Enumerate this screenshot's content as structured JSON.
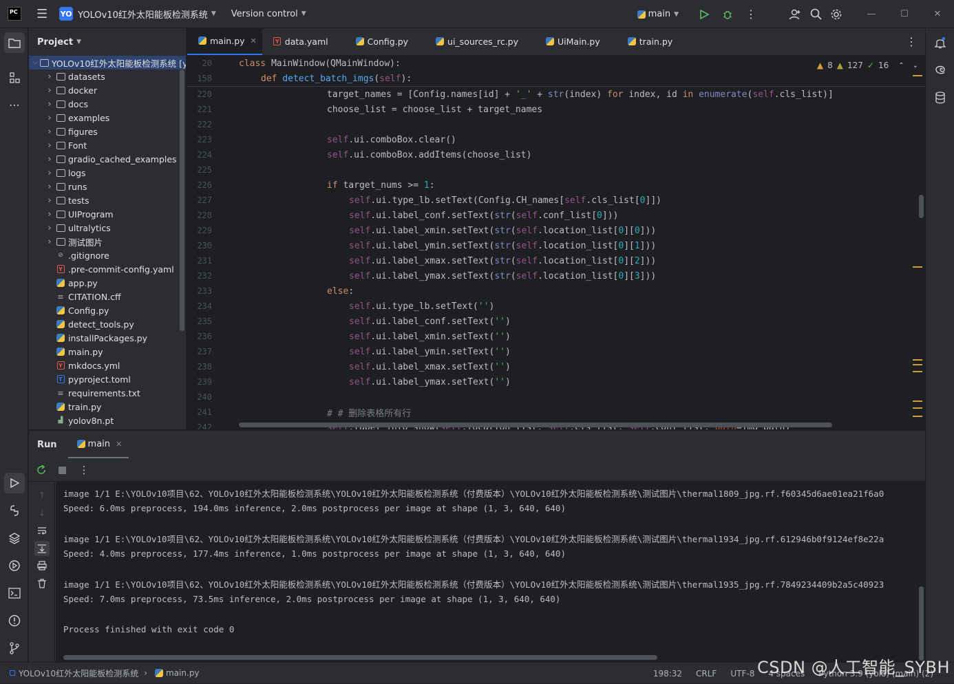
{
  "titlebar": {
    "logo": "PC",
    "project_badge": "YO",
    "project_name": "YOLOv10红外太阳能板检测系统",
    "vcs_label": "Version control",
    "run_config": "main"
  },
  "project_panel": {
    "title": "Project",
    "root": "YOLOv10红外太阳能板检测系统 [y",
    "items": [
      {
        "label": "datasets",
        "type": "folder"
      },
      {
        "label": "docker",
        "type": "folder"
      },
      {
        "label": "docs",
        "type": "folder"
      },
      {
        "label": "examples",
        "type": "folder"
      },
      {
        "label": "figures",
        "type": "folder"
      },
      {
        "label": "Font",
        "type": "folder"
      },
      {
        "label": "gradio_cached_examples",
        "type": "folder"
      },
      {
        "label": "logs",
        "type": "folder"
      },
      {
        "label": "runs",
        "type": "folder"
      },
      {
        "label": "tests",
        "type": "folder"
      },
      {
        "label": "UIProgram",
        "type": "package"
      },
      {
        "label": "ultralytics",
        "type": "package"
      },
      {
        "label": "测试图片",
        "type": "folder"
      },
      {
        "label": ".gitignore",
        "type": "ignore"
      },
      {
        "label": ".pre-commit-config.yaml",
        "type": "yaml"
      },
      {
        "label": "app.py",
        "type": "py"
      },
      {
        "label": "CITATION.cff",
        "type": "txt"
      },
      {
        "label": "Config.py",
        "type": "py"
      },
      {
        "label": "detect_tools.py",
        "type": "py"
      },
      {
        "label": "installPackages.py",
        "type": "py"
      },
      {
        "label": "main.py",
        "type": "py"
      },
      {
        "label": "mkdocs.yml",
        "type": "yaml"
      },
      {
        "label": "pyproject.toml",
        "type": "toml"
      },
      {
        "label": "requirements.txt",
        "type": "txt"
      },
      {
        "label": "train.py",
        "type": "py"
      },
      {
        "label": "yolov8n.pt",
        "type": "pt"
      }
    ]
  },
  "editor_tabs": [
    {
      "label": "main.py",
      "icon": "py",
      "active": true
    },
    {
      "label": "data.yaml",
      "icon": "yaml",
      "active": false
    },
    {
      "label": "Config.py",
      "icon": "py",
      "active": false
    },
    {
      "label": "ui_sources_rc.py",
      "icon": "py",
      "active": false
    },
    {
      "label": "UiMain.py",
      "icon": "py",
      "active": false
    },
    {
      "label": "train.py",
      "icon": "py",
      "active": false
    }
  ],
  "inspections": {
    "warnings": "8",
    "weak_warnings": "127",
    "typos": "16"
  },
  "code_lines": [
    {
      "n": "20",
      "indent": 0,
      "toks": [
        [
          "kw",
          "class "
        ],
        [
          "tx",
          "MainWindow(QMainWindow):"
        ]
      ]
    },
    {
      "n": "158",
      "indent": 4,
      "toks": [
        [
          "kw",
          "def "
        ],
        [
          "fn",
          "detect_batch_imgs"
        ],
        [
          "tx",
          "("
        ],
        [
          "self",
          "self"
        ],
        [
          "tx",
          "):"
        ]
      ]
    },
    {
      "n": "220",
      "indent": 16,
      "toks": [
        [
          "tx",
          "target_names = [Config.names[id] + "
        ],
        [
          "str",
          "'_'"
        ],
        [
          "tx",
          " + "
        ],
        [
          "bi",
          "str"
        ],
        [
          "tx",
          "(index) "
        ],
        [
          "kw",
          "for "
        ],
        [
          "tx",
          "index, id "
        ],
        [
          "kw",
          "in "
        ],
        [
          "bi",
          "enumerate"
        ],
        [
          "tx",
          "("
        ],
        [
          "self",
          "self"
        ],
        [
          "tx",
          ".cls_list)]"
        ]
      ]
    },
    {
      "n": "221",
      "indent": 16,
      "toks": [
        [
          "tx",
          "choose_list = choose_list + target_names"
        ]
      ]
    },
    {
      "n": "222",
      "indent": 0,
      "toks": []
    },
    {
      "n": "223",
      "indent": 16,
      "toks": [
        [
          "self",
          "self"
        ],
        [
          "tx",
          ".ui.comboBox.clear()"
        ]
      ]
    },
    {
      "n": "224",
      "indent": 16,
      "toks": [
        [
          "self",
          "self"
        ],
        [
          "tx",
          ".ui.comboBox.addItems(choose_list)"
        ]
      ]
    },
    {
      "n": "225",
      "indent": 0,
      "toks": []
    },
    {
      "n": "226",
      "indent": 16,
      "toks": [
        [
          "kw",
          "if "
        ],
        [
          "tx",
          "target_nums >= "
        ],
        [
          "num",
          "1"
        ],
        [
          "tx",
          ":"
        ]
      ]
    },
    {
      "n": "227",
      "indent": 20,
      "toks": [
        [
          "self",
          "self"
        ],
        [
          "tx",
          ".ui.type_lb.setText(Config.CH_names["
        ],
        [
          "self",
          "self"
        ],
        [
          "tx",
          ".cls_list["
        ],
        [
          "num",
          "0"
        ],
        [
          "tx",
          "]])"
        ]
      ]
    },
    {
      "n": "228",
      "indent": 20,
      "toks": [
        [
          "self",
          "self"
        ],
        [
          "tx",
          ".ui.label_conf.setText("
        ],
        [
          "bi",
          "str"
        ],
        [
          "tx",
          "("
        ],
        [
          "self",
          "self"
        ],
        [
          "tx",
          ".conf_list["
        ],
        [
          "num",
          "0"
        ],
        [
          "tx",
          "]))"
        ]
      ]
    },
    {
      "n": "229",
      "indent": 20,
      "toks": [
        [
          "self",
          "self"
        ],
        [
          "tx",
          ".ui.label_xmin.setText("
        ],
        [
          "bi",
          "str"
        ],
        [
          "tx",
          "("
        ],
        [
          "self",
          "self"
        ],
        [
          "tx",
          ".location_list["
        ],
        [
          "num",
          "0"
        ],
        [
          "tx",
          "]["
        ],
        [
          "num",
          "0"
        ],
        [
          "tx",
          "]))"
        ]
      ]
    },
    {
      "n": "230",
      "indent": 20,
      "toks": [
        [
          "self",
          "self"
        ],
        [
          "tx",
          ".ui.label_ymin.setText("
        ],
        [
          "bi",
          "str"
        ],
        [
          "tx",
          "("
        ],
        [
          "self",
          "self"
        ],
        [
          "tx",
          ".location_list["
        ],
        [
          "num",
          "0"
        ],
        [
          "tx",
          "]["
        ],
        [
          "num",
          "1"
        ],
        [
          "tx",
          "]))"
        ]
      ]
    },
    {
      "n": "231",
      "indent": 20,
      "toks": [
        [
          "self",
          "self"
        ],
        [
          "tx",
          ".ui.label_xmax.setText("
        ],
        [
          "bi",
          "str"
        ],
        [
          "tx",
          "("
        ],
        [
          "self",
          "self"
        ],
        [
          "tx",
          ".location_list["
        ],
        [
          "num",
          "0"
        ],
        [
          "tx",
          "]["
        ],
        [
          "num",
          "2"
        ],
        [
          "tx",
          "]))"
        ]
      ]
    },
    {
      "n": "232",
      "indent": 20,
      "toks": [
        [
          "self",
          "self"
        ],
        [
          "tx",
          ".ui.label_ymax.setText("
        ],
        [
          "bi",
          "str"
        ],
        [
          "tx",
          "("
        ],
        [
          "self",
          "self"
        ],
        [
          "tx",
          ".location_list["
        ],
        [
          "num",
          "0"
        ],
        [
          "tx",
          "]["
        ],
        [
          "num",
          "3"
        ],
        [
          "tx",
          "]))"
        ]
      ]
    },
    {
      "n": "233",
      "indent": 16,
      "toks": [
        [
          "kw",
          "else"
        ],
        [
          "tx",
          ":"
        ]
      ]
    },
    {
      "n": "234",
      "indent": 20,
      "toks": [
        [
          "self",
          "self"
        ],
        [
          "tx",
          ".ui.type_lb.setText("
        ],
        [
          "str",
          "''"
        ],
        [
          "tx",
          ")"
        ]
      ]
    },
    {
      "n": "235",
      "indent": 20,
      "toks": [
        [
          "self",
          "self"
        ],
        [
          "tx",
          ".ui.label_conf.setText("
        ],
        [
          "str",
          "''"
        ],
        [
          "tx",
          ")"
        ]
      ]
    },
    {
      "n": "236",
      "indent": 20,
      "toks": [
        [
          "self",
          "self"
        ],
        [
          "tx",
          ".ui.label_xmin.setText("
        ],
        [
          "str",
          "''"
        ],
        [
          "tx",
          ")"
        ]
      ]
    },
    {
      "n": "237",
      "indent": 20,
      "toks": [
        [
          "self",
          "self"
        ],
        [
          "tx",
          ".ui.label_ymin.setText("
        ],
        [
          "str",
          "''"
        ],
        [
          "tx",
          ")"
        ]
      ]
    },
    {
      "n": "238",
      "indent": 20,
      "toks": [
        [
          "self",
          "self"
        ],
        [
          "tx",
          ".ui.label_xmax.setText("
        ],
        [
          "str",
          "''"
        ],
        [
          "tx",
          ")"
        ]
      ]
    },
    {
      "n": "239",
      "indent": 20,
      "toks": [
        [
          "self",
          "self"
        ],
        [
          "tx",
          ".ui.label_ymax.setText("
        ],
        [
          "str",
          "''"
        ],
        [
          "tx",
          ")"
        ]
      ]
    },
    {
      "n": "240",
      "indent": 0,
      "toks": []
    },
    {
      "n": "241",
      "indent": 16,
      "toks": [
        [
          "cm",
          "# # 删除表格所有行"
        ]
      ]
    },
    {
      "n": "242",
      "indent": 16,
      "toks": [
        [
          "self",
          "self"
        ],
        [
          "tx",
          ".tabel_info_show("
        ],
        [
          "self",
          "self"
        ],
        [
          "tx",
          ".location_list, "
        ],
        [
          "self",
          "self"
        ],
        [
          "tx",
          ".cls_list, "
        ],
        [
          "self",
          "self"
        ],
        [
          "tx",
          ".conf_list, "
        ],
        [
          "pa",
          "path"
        ],
        [
          "tx",
          "=img_path)"
        ]
      ]
    }
  ],
  "run_panel": {
    "title": "Run",
    "tab": "main",
    "console": [
      "image 1/1 E:\\YOLOv10项目\\62、YOLOv10红外太阳能板检测系统\\YOLOv10红外太阳能板检测系统（付费版本）\\YOLOv10红外太阳能板检测系统\\测试图片\\thermal1809_jpg.rf.f60345d6ae01ea21f6a0",
      "Speed: 6.0ms preprocess, 194.0ms inference, 2.0ms postprocess per image at shape (1, 3, 640, 640)",
      "",
      "image 1/1 E:\\YOLOv10项目\\62、YOLOv10红外太阳能板检测系统\\YOLOv10红外太阳能板检测系统（付费版本）\\YOLOv10红外太阳能板检测系统\\测试图片\\thermal1934_jpg.rf.612946b0f9124ef8e22a",
      "Speed: 4.0ms preprocess, 177.4ms inference, 1.0ms postprocess per image at shape (1, 3, 640, 640)",
      "",
      "image 1/1 E:\\YOLOv10项目\\62、YOLOv10红外太阳能板检测系统\\YOLOv10红外太阳能板检测系统（付费版本）\\YOLOv10红外太阳能板检测系统\\测试图片\\thermal1935_jpg.rf.7849234409b2a5c40923",
      "Speed: 7.0ms preprocess, 73.5ms inference, 2.0ms postprocess per image at shape (1, 3, 640, 640)",
      "",
      "Process finished with exit code 0"
    ]
  },
  "statusbar": {
    "breadcrumb_project": "YOLOv10红外太阳能板检测系统",
    "breadcrumb_file": "main.py",
    "position": "198:32",
    "line_sep": "CRLF",
    "encoding": "UTF-8",
    "indent": "4 spaces",
    "interpreter": "Python 3.9 (yolo) (main) (2)"
  },
  "watermark": "CSDN @人工智能_SYBH",
  "colors": {
    "accent": "#3574f0",
    "warning": "#d29e3a",
    "selection": "#2e436e"
  }
}
